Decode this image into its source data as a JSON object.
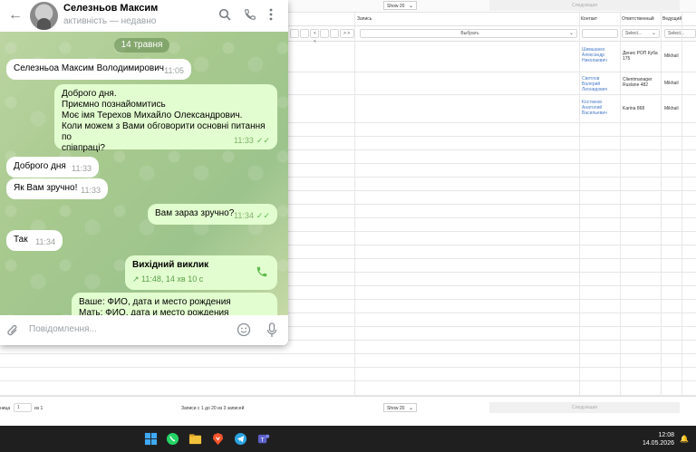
{
  "crm": {
    "top_show": "Show 20",
    "top_next": "Следующая",
    "headers": {
      "record": "Запись",
      "contact": "Контакт",
      "responsible": "Ответственный",
      "lead": "Ведущий"
    },
    "filters": {
      "record_select": "Выбрать",
      "responsible_select": "Select...",
      "lead_select": "Select...",
      "nav_prev": "< <",
      "nav_next": "> >"
    },
    "rows": [
      {
        "contact": "Шимшанко Александр Николаевич",
        "responsible": "Денис РОП Куба 175",
        "lead": "Mikhail"
      },
      {
        "contact": "Светлов Валерий Леонидович",
        "responsible": "Clientmanager Ruslane 482",
        "lead": "Mikhail"
      },
      {
        "contact": "Костюков Анатолий Васильевич",
        "responsible": "Karina 868",
        "lead": "Mikhail"
      }
    ],
    "bottom": {
      "page_label": "ница",
      "page_value": "1",
      "page_of": "из 1",
      "records_info": "Записи с 1 до 20 из 3 записей",
      "show": "Show 20",
      "next": "Следующая"
    }
  },
  "telegram": {
    "contact_name": "Селезньов Максим",
    "contact_status": "активність — недавно",
    "date_pill": "14 травня",
    "messages": [
      {
        "text": "Селезньоа Максим Володимирович",
        "time": "11:05"
      },
      {
        "text_lines": [
          "Доброго дня.",
          "Приємно познайомитись",
          "Моє імя Терехов Михайло Олександрович.",
          "Коли можем з Вами обговорити основні питання по",
          "співпраці?"
        ],
        "time": "11:33"
      },
      {
        "text": "Доброго дня",
        "time": "11:33"
      },
      {
        "text": "Як Вам зручно!",
        "time": "11:33"
      },
      {
        "text": "Вам зараз зручно?",
        "time": "11:34"
      },
      {
        "text": "Так",
        "time": "11:34"
      },
      {
        "call_title": "Вихідний виклик",
        "call_sub": "11:48, 14 хв 10 с"
      },
      {
        "text_lines": [
          "Ваше: ФИО, дата и место рождения",
          "Мать: ФИО, дата и место рождения"
        ]
      }
    ],
    "input_placeholder": "Повідомлення..."
  },
  "taskbar": {
    "time": "12:08",
    "date": "14.05.2026"
  },
  "colors": {
    "accent_green": "#5fbc4f",
    "bubble_out": "#e2fdcf",
    "link_blue": "#4a7cc8"
  }
}
